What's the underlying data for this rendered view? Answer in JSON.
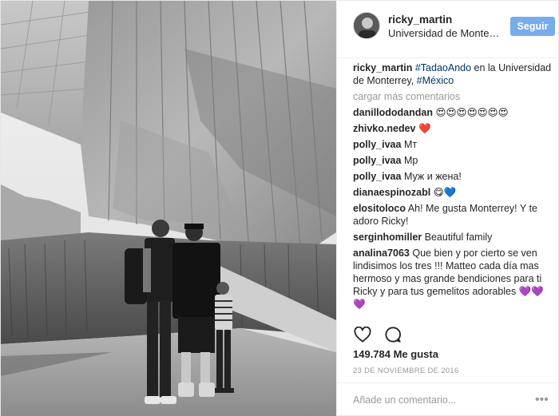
{
  "post": {
    "username": "ricky_martin",
    "location": "Universidad de Monterrey",
    "follow_label": "Seguir"
  },
  "caption": {
    "username": "ricky_martin",
    "part1": "#TadaoAndo",
    "part2": " en la Universidad de Monterrey, ",
    "part3": "#México"
  },
  "load_more": "cargar más comentarios",
  "comments": [
    {
      "user": "danillododandan",
      "text": "😍😍😍😍😍😍😍"
    },
    {
      "user": "zhivko.nedev",
      "text": "❤️"
    },
    {
      "user": "polly_ivaa",
      "text": "Мт"
    },
    {
      "user": "polly_ivaa",
      "text": "Мр"
    },
    {
      "user": "polly_ivaa",
      "text": "Муж и жена!"
    },
    {
      "user": "dianaespinozabl",
      "text": "😋💙"
    },
    {
      "user": "elositoloco",
      "text": "Ah! Me gusta Monterrey! Y te adoro Ricky!"
    },
    {
      "user": "serginhomiller",
      "text": "Beautiful family"
    },
    {
      "user": "analina7063",
      "text": "Que bien y por cierto se ven lindisimos los tres !!! Matteo cada día mas hermoso y mas grande bendiciones para ti Ricky y para tus gemelitos adorables 💜💜💜"
    }
  ],
  "actions": {
    "like_icon": "heart-outline-icon",
    "comment_icon": "speech-bubble-icon"
  },
  "likes": "149.784 Me gusta",
  "date": "23 DE NOVIEMBRE DE 2016",
  "add_comment": {
    "placeholder": "Añade un comentario...",
    "more": "•••"
  }
}
